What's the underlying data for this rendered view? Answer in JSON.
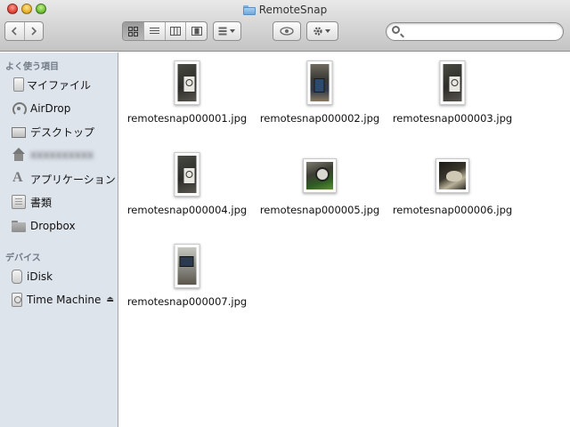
{
  "window": {
    "title": "RemoteSnap",
    "icon": "folder-icon"
  },
  "toolbar": {
    "back_icon": "chevron-left-icon",
    "forward_icon": "chevron-right-icon",
    "view_icons": [
      "icon-view-icon",
      "list-view-icon",
      "column-view-icon",
      "coverflow-view-icon"
    ],
    "active_view": "icon-view",
    "arrange_icon": "arrange-icon",
    "quicklook_icon": "eye-icon",
    "action_icon": "gear-icon",
    "search": {
      "value": "",
      "placeholder": ""
    }
  },
  "sidebar": {
    "favorites_header": "よく使う項目",
    "favorites": [
      {
        "label": "マイファイル",
        "icon": "all-my-files-icon"
      },
      {
        "label": "AirDrop",
        "icon": "airdrop-icon"
      },
      {
        "label": "デスクトップ",
        "icon": "desktop-icon"
      },
      {
        "label": "obscured-name",
        "icon": "home-icon"
      },
      {
        "label": "アプリケーション",
        "icon": "applications-icon"
      },
      {
        "label": "書類",
        "icon": "documents-icon"
      },
      {
        "label": "Dropbox",
        "icon": "folder-icon"
      }
    ],
    "devices_header": "デバイス",
    "devices": [
      {
        "label": "iDisk",
        "icon": "idisk-icon"
      },
      {
        "label": "Time Machine",
        "icon": "time-machine-icon",
        "eject": "⏏"
      }
    ]
  },
  "files": [
    {
      "name": "remotesnap000001.jpg",
      "orientation": "portrait"
    },
    {
      "name": "remotesnap000002.jpg",
      "orientation": "portrait"
    },
    {
      "name": "remotesnap000003.jpg",
      "orientation": "portrait"
    },
    {
      "name": "remotesnap000004.jpg",
      "orientation": "portrait"
    },
    {
      "name": "remotesnap000005.jpg",
      "orientation": "landscape"
    },
    {
      "name": "remotesnap000006.jpg",
      "orientation": "landscape"
    },
    {
      "name": "remotesnap000007.jpg",
      "orientation": "portrait"
    }
  ]
}
